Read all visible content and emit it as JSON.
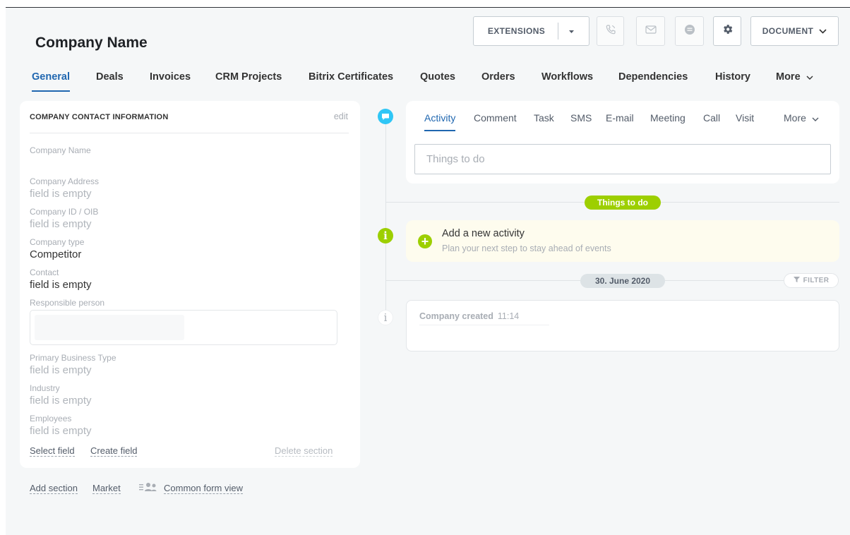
{
  "header": {
    "title": "Company Name",
    "extensions_label": "EXTENSIONS",
    "document_label": "DOCUMENT"
  },
  "tabs": [
    {
      "label": "General",
      "active": true
    },
    {
      "label": "Deals"
    },
    {
      "label": "Invoices"
    },
    {
      "label": "CRM Projects"
    },
    {
      "label": "Bitrix Certificates"
    },
    {
      "label": "Quotes"
    },
    {
      "label": "Orders"
    },
    {
      "label": "Workflows"
    },
    {
      "label": "Dependencies"
    },
    {
      "label": "History"
    },
    {
      "label": "More"
    }
  ],
  "contact_section": {
    "title": "COMPANY CONTACT INFORMATION",
    "edit_label": "edit",
    "fields": [
      {
        "label": "Company Name",
        "value": ""
      },
      {
        "label": "Company Address",
        "value": "field is empty"
      },
      {
        "label": "Company ID / OIB",
        "value": "field is empty"
      },
      {
        "label": "Company type",
        "value": "Competitor"
      },
      {
        "label": "Contact",
        "value": "field is empty"
      },
      {
        "label": "Responsible person",
        "value": ""
      },
      {
        "label": "Primary Business Type",
        "value": "field is empty"
      },
      {
        "label": "Industry",
        "value": "field is empty"
      },
      {
        "label": "Employees",
        "value": "field is empty"
      }
    ],
    "select_field": "Select field",
    "create_field": "Create field",
    "delete_section": "Delete section"
  },
  "below_links": {
    "add_section": "Add section",
    "market": "Market",
    "common_form_view": "Common form view"
  },
  "activity": {
    "tabs": [
      "Activity",
      "Comment",
      "Task",
      "SMS",
      "E-mail",
      "Meeting",
      "Call",
      "Visit",
      "More"
    ],
    "input_placeholder": "Things to do",
    "things_to_do_badge": "Things to do",
    "add_title": "Add a new activity",
    "add_subtitle": "Plan your next step to stay ahead of events",
    "date_badge": "30. June 2020",
    "filter_label": "FILTER",
    "history_item": {
      "text": "Company created",
      "time": "11:14"
    }
  },
  "colors": {
    "accent": "#2067b0",
    "green": "#9dcf00",
    "comment_blue": "#2fc6f6"
  },
  "icons": [
    "chevron-down-icon",
    "phone-icon",
    "mail-icon",
    "chat-icon",
    "gear-icon",
    "comment-icon",
    "info-icon",
    "plus-icon",
    "filter-icon",
    "people-icon"
  ]
}
